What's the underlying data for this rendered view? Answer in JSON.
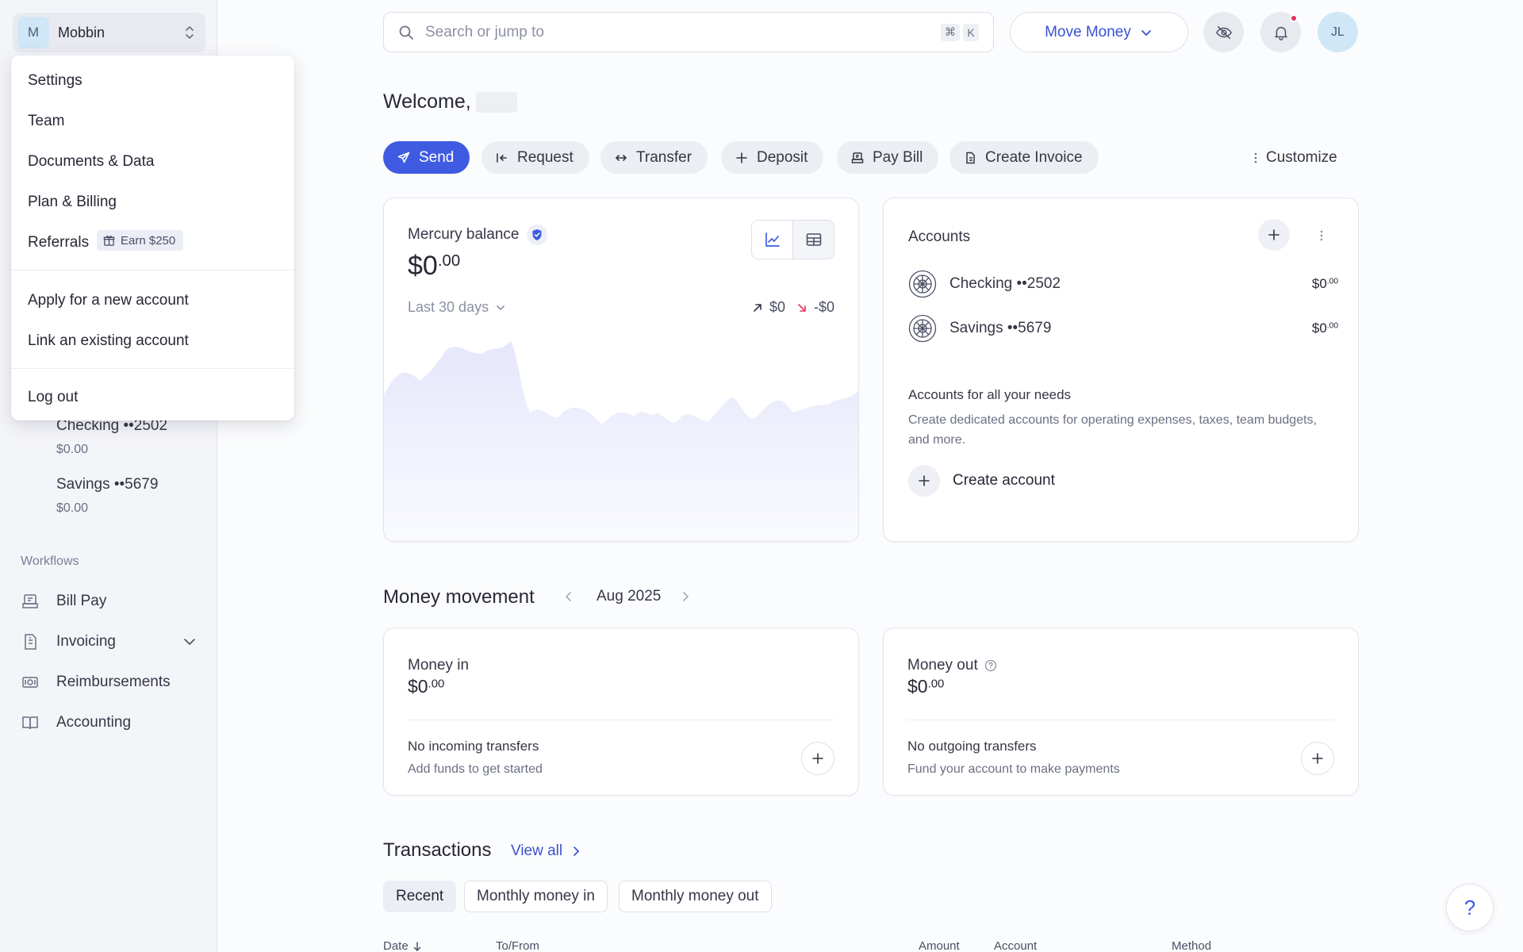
{
  "org": {
    "initial": "M",
    "name": "Mobbin"
  },
  "org_menu": {
    "items": [
      "Settings",
      "Team",
      "Documents & Data",
      "Plan & Billing",
      "Referrals"
    ],
    "referral_badge": "Earn $250",
    "account_actions": [
      "Apply for a new account",
      "Link an existing account"
    ],
    "logout": "Log out"
  },
  "sidebar": {
    "accounts": [
      {
        "name": "Checking ••2502",
        "balance": "$0.00"
      },
      {
        "name": "Savings ••5679",
        "balance": "$0.00"
      }
    ],
    "workflows_label": "Workflows",
    "workflows": [
      "Bill Pay",
      "Invoicing",
      "Reimbursements",
      "Accounting"
    ]
  },
  "topbar": {
    "search_placeholder": "Search or jump to",
    "shortcut_keys": [
      "⌘",
      "K"
    ],
    "move_money": "Move Money",
    "user_initials": "JL"
  },
  "welcome": "Welcome,",
  "actions": [
    "Send",
    "Request",
    "Transfer",
    "Deposit",
    "Pay Bill",
    "Create Invoice"
  ],
  "customize": "Customize",
  "balance_card": {
    "label": "Mercury balance",
    "amount_whole": "$0",
    "amount_cents": ".00",
    "period": "Last 30 days",
    "inflow": "$0",
    "outflow": "-$0"
  },
  "accounts_card": {
    "title": "Accounts",
    "accounts": [
      {
        "name": "Checking ••2502",
        "whole": "$0",
        "cents": ".00"
      },
      {
        "name": "Savings ••5679",
        "whole": "$0",
        "cents": ".00"
      }
    ],
    "promo_title": "Accounts for all your needs",
    "promo_text": "Create dedicated accounts for operating expenses, taxes, team budgets, and more.",
    "create_label": "Create account"
  },
  "money_movement": {
    "title": "Money movement",
    "month": "Aug 2025",
    "in": {
      "label": "Money in",
      "whole": "$0",
      "cents": ".00",
      "empty_title": "No incoming transfers",
      "empty_sub": "Add funds to get started"
    },
    "out": {
      "label": "Money out",
      "whole": "$0",
      "cents": ".00",
      "empty_title": "No outgoing transfers",
      "empty_sub": "Fund your account to make payments"
    }
  },
  "transactions": {
    "title": "Transactions",
    "view_all": "View all",
    "tabs": [
      "Recent",
      "Monthly money in",
      "Monthly money out"
    ],
    "columns": [
      "Date",
      "To/From",
      "Amount",
      "Account",
      "Method"
    ]
  },
  "help": "?",
  "colors": {
    "accent": "#3f5be2",
    "link": "#3a51d1",
    "notification": "#e2325f",
    "sidebar_bg": "#f4f5f9"
  }
}
